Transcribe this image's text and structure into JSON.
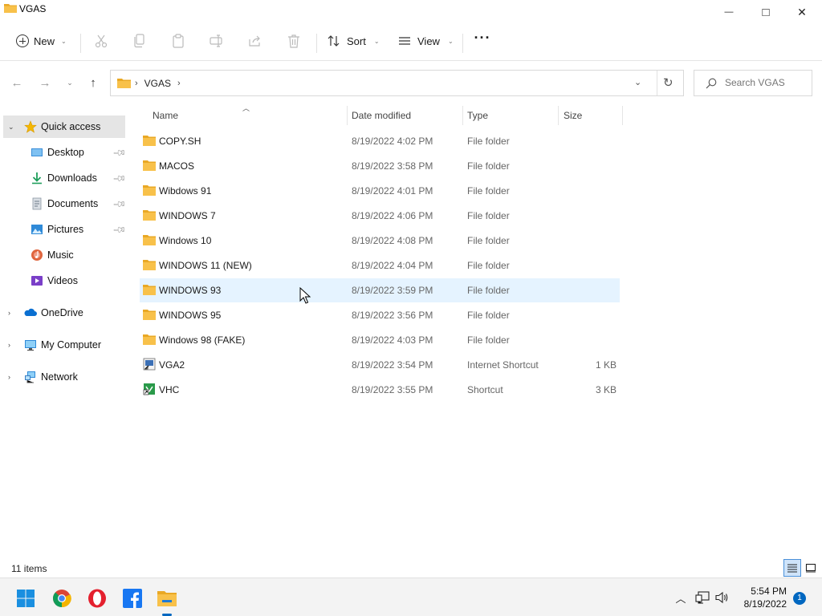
{
  "window": {
    "title": "VGAS",
    "minimize_glyph": "—",
    "maximize_glyph": "□",
    "close_glyph": "✕"
  },
  "commandbar": {
    "new_label": "New",
    "sort_label": "Sort",
    "view_label": "View",
    "more_label": "···",
    "icons": [
      "cut-icon",
      "copy-icon",
      "paste-icon",
      "rename-icon",
      "share-icon",
      "delete-icon"
    ]
  },
  "address": {
    "crumbs": [
      "VGAS"
    ],
    "chevron": "›"
  },
  "search": {
    "placeholder": "Search VGAS"
  },
  "navpane": {
    "quick_access": {
      "label": "Quick access"
    },
    "pinned": [
      {
        "label": "Desktop",
        "icon": "desktop-icon",
        "pinned": true
      },
      {
        "label": "Downloads",
        "icon": "download-icon",
        "pinned": true
      },
      {
        "label": "Documents",
        "icon": "documents-icon",
        "pinned": true
      },
      {
        "label": "Pictures",
        "icon": "pictures-icon",
        "pinned": true
      },
      {
        "label": "Music",
        "icon": "music-icon",
        "pinned": false
      },
      {
        "label": "Videos",
        "icon": "videos-icon",
        "pinned": false
      }
    ],
    "roots": [
      {
        "label": "OneDrive",
        "icon": "onedrive-icon"
      },
      {
        "label": "My Computer",
        "icon": "computer-icon"
      },
      {
        "label": "Network",
        "icon": "network-icon"
      }
    ]
  },
  "columns": {
    "name": "Name",
    "date": "Date modified",
    "type": "Type",
    "size": "Size"
  },
  "files": [
    {
      "name": "COPY.SH",
      "date": "8/19/2022 4:02 PM",
      "type": "File folder",
      "size": "",
      "icon": "folder-icon"
    },
    {
      "name": "MACOS",
      "date": "8/19/2022 3:58 PM",
      "type": "File folder",
      "size": "",
      "icon": "folder-icon"
    },
    {
      "name": "Wibdows 91",
      "date": "8/19/2022 4:01 PM",
      "type": "File folder",
      "size": "",
      "icon": "folder-icon"
    },
    {
      "name": "WINDOWS 7",
      "date": "8/19/2022 4:06 PM",
      "type": "File folder",
      "size": "",
      "icon": "folder-icon"
    },
    {
      "name": "Windows 10",
      "date": "8/19/2022 4:08 PM",
      "type": "File folder",
      "size": "",
      "icon": "folder-icon"
    },
    {
      "name": "WINDOWS 11 (NEW)",
      "date": "8/19/2022 4:04 PM",
      "type": "File folder",
      "size": "",
      "icon": "folder-icon"
    },
    {
      "name": "WINDOWS 93",
      "date": "8/19/2022 3:59 PM",
      "type": "File folder",
      "size": "",
      "icon": "folder-icon",
      "hover": true
    },
    {
      "name": "WINDOWS 95",
      "date": "8/19/2022 3:56 PM",
      "type": "File folder",
      "size": "",
      "icon": "folder-icon"
    },
    {
      "name": "Windows 98 (FAKE)",
      "date": "8/19/2022 4:03 PM",
      "type": "File folder",
      "size": "",
      "icon": "folder-icon"
    },
    {
      "name": "VGA2",
      "date": "8/19/2022 3:54 PM",
      "type": "Internet Shortcut",
      "size": "1 KB",
      "icon": "internet-shortcut-icon"
    },
    {
      "name": "VHC",
      "date": "8/19/2022 3:55 PM",
      "type": "Shortcut",
      "size": "3 KB",
      "icon": "shortcut-icon"
    }
  ],
  "status": {
    "count": "11 items"
  },
  "taskbar": {
    "apps": [
      "start-icon",
      "chrome-icon",
      "opera-icon",
      "facebook-icon",
      "file-explorer-icon"
    ],
    "time": "5:54 PM",
    "date": "8/19/2022",
    "notifications": "1"
  },
  "colors": {
    "accent": "#0067c0",
    "hover_row": "#e5f3ff",
    "selected_nav": "#e5e5e5",
    "folder": "#f8c14a"
  }
}
